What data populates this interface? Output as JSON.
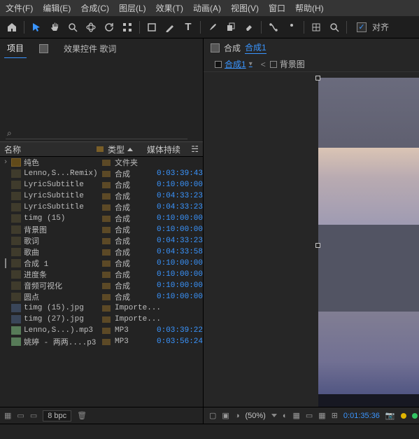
{
  "menu": {
    "file": "文件(F)",
    "edit": "编辑(E)",
    "composition": "合成(C)",
    "layer": "图层(L)",
    "effect": "效果(T)",
    "animation": "动画(A)",
    "view": "视图(V)",
    "window": "窗口",
    "help": "帮助(H)"
  },
  "toolbar": {
    "snap_label": "对齐"
  },
  "left_tabs": {
    "project": "项目",
    "effect_controls": "效果控件 歌词"
  },
  "search": {
    "placeholder": ""
  },
  "columns": {
    "name": "名称",
    "type": "类型",
    "media_dur": "媒体持续"
  },
  "items": [
    {
      "icon": "folder",
      "name": "纯色",
      "type": "文件夹",
      "dur": ""
    },
    {
      "icon": "comp",
      "name": "Lenno,S...Remix)",
      "type": "合成",
      "dur": "0:03:39:43"
    },
    {
      "icon": "comp",
      "name": "LyricSubtitle",
      "type": "合成",
      "dur": "0:10:00:00"
    },
    {
      "icon": "comp",
      "name": "LyricSubtitle",
      "type": "合成",
      "dur": "0:04:33:23"
    },
    {
      "icon": "comp",
      "name": "LyricSubtitle",
      "type": "合成",
      "dur": "0:04:33:23"
    },
    {
      "icon": "comp",
      "name": "timg (15)",
      "type": "合成",
      "dur": "0:10:00:00"
    },
    {
      "icon": "comp",
      "name": "背景图",
      "type": "合成",
      "dur": "0:10:00:00"
    },
    {
      "icon": "comp",
      "name": "歌词",
      "type": "合成",
      "dur": "0:04:33:23"
    },
    {
      "icon": "comp",
      "name": "歌曲",
      "type": "合成",
      "dur": "0:04:33:58"
    },
    {
      "icon": "comp",
      "name": "合成 1",
      "type": "合成",
      "dur": "0:10:00:00",
      "check": true
    },
    {
      "icon": "comp",
      "name": "进度条",
      "type": "合成",
      "dur": "0:10:00:00"
    },
    {
      "icon": "comp",
      "name": "音频可视化",
      "type": "合成",
      "dur": "0:10:00:00"
    },
    {
      "icon": "comp",
      "name": "圆点",
      "type": "合成",
      "dur": "0:10:00:00"
    },
    {
      "icon": "image",
      "name": "timg (15).jpg",
      "type": "Importe...",
      "dur": ""
    },
    {
      "icon": "image",
      "name": "timg (27).jpg",
      "type": "Importe...",
      "dur": ""
    },
    {
      "icon": "audio",
      "name": "Lenno,S...).mp3",
      "type": "MP3",
      "dur": "0:03:39:22"
    },
    {
      "icon": "audio",
      "name": "姚婷 - 两两....p3",
      "type": "MP3",
      "dur": "0:03:56:24"
    }
  ],
  "left_bottom": {
    "bpc": "8 bpc"
  },
  "comp_tabs": {
    "prefix": "合成",
    "name": "合成1",
    "menu": "≡"
  },
  "sub_tabs": {
    "t1": "合成1",
    "t2": "背景图"
  },
  "right_bottom": {
    "zoom": "(50%)",
    "timecode": "0:01:35:36"
  }
}
